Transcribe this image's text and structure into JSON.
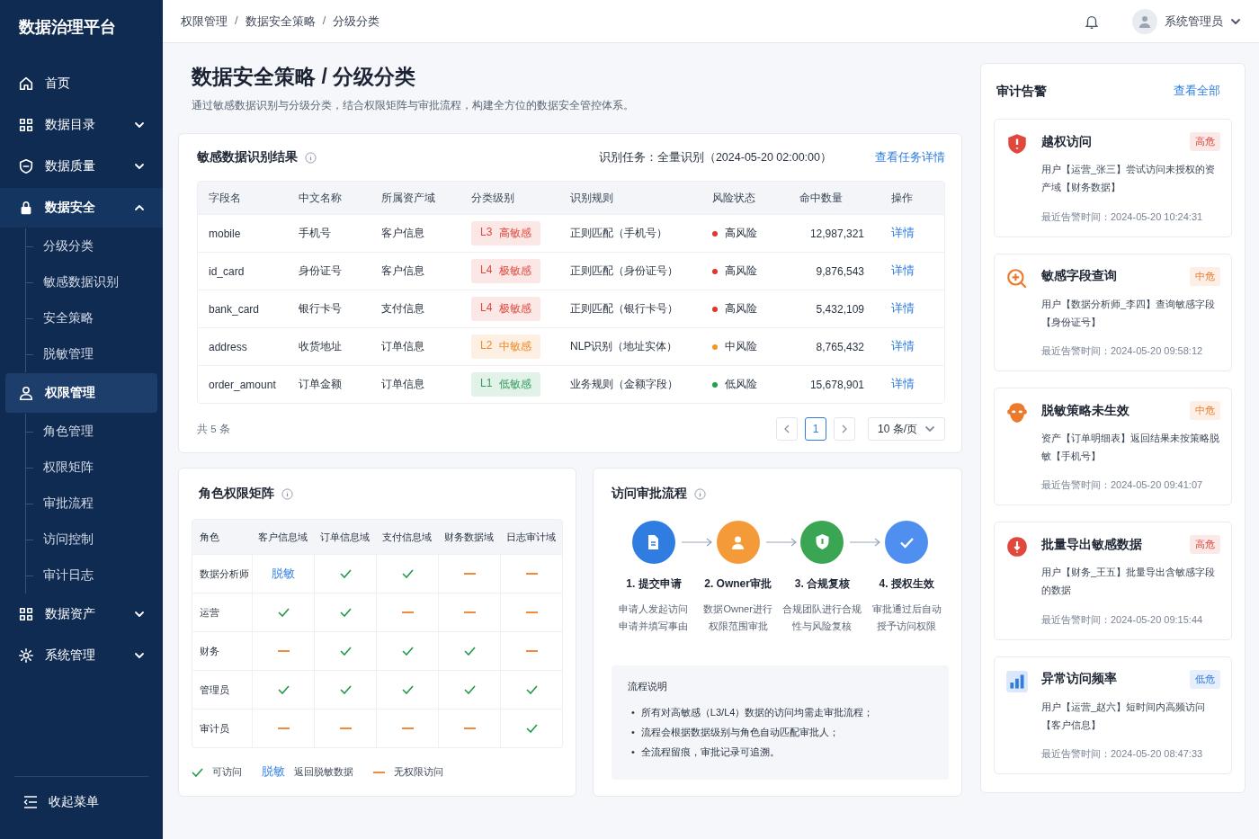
{
  "sidebar": {
    "title": "数据治理平台",
    "items": [
      {
        "label": "首页",
        "selected": false
      },
      {
        "label": "数据目录",
        "selected": false,
        "expanded": false
      },
      {
        "label": "数据质量",
        "selected": false,
        "expanded": false
      },
      {
        "label": "数据安全",
        "selected": false,
        "expanded": true,
        "children": [
          {
            "label": "分级分类",
            "selected": false
          },
          {
            "label": "敏感数据识别",
            "selected": false
          },
          {
            "label": "安全策略",
            "selected": false
          },
          {
            "label": "脱敏管理",
            "selected": false
          }
        ]
      },
      {
        "label": "权限管理",
        "selected": true,
        "children": [
          {
            "label": "角色管理",
            "selected": false
          },
          {
            "label": "权限矩阵",
            "selected": false
          },
          {
            "label": "审批流程",
            "selected": false
          },
          {
            "label": "访问控制",
            "selected": false
          },
          {
            "label": "审计日志",
            "selected": false
          }
        ]
      },
      {
        "label": "数据资产",
        "selected": false,
        "expanded": false
      },
      {
        "label": "系统管理",
        "selected": false,
        "expanded": false
      }
    ],
    "collapse": "收起菜单"
  },
  "topbar": {
    "breadcrumb": [
      "权限管理",
      "数据安全策略",
      "分级分类"
    ],
    "separator": "/",
    "user": "系统管理员"
  },
  "page": {
    "title": "数据安全策略 / 分级分类",
    "subtitle": "通过敏感数据识别与分级分类，结合权限矩阵与审批流程，构建全方位的数据安全管控体系。"
  },
  "recognition": {
    "title": "敏感数据识别结果",
    "task": "识别任务：全量识别（2024-05-20 02:00:00）",
    "task_link": "查看任务详情",
    "columns": [
      "字段名",
      "中文名称",
      "所属资产域",
      "分类级别",
      "识别规则",
      "风险状态",
      "命中数量",
      "操作"
    ],
    "rows": [
      {
        "field": "mobile",
        "name": "手机号",
        "domain": "客户信息",
        "level": {
          "code": "L3",
          "label": "高敏感",
          "color": "#e0483e"
        },
        "rule": "正则匹配（手机号）",
        "risk": {
          "label": "高风险",
          "color": "#e0362c"
        },
        "count": "12,987,321",
        "action": "详情"
      },
      {
        "field": "id_card",
        "name": "身份证号",
        "domain": "客户信息",
        "level": {
          "code": "L4",
          "label": "极敏感",
          "color": "#e0483e"
        },
        "rule": "正则匹配（身份证号）",
        "risk": {
          "label": "高风险",
          "color": "#e0362c"
        },
        "count": "9,876,543",
        "action": "详情"
      },
      {
        "field": "bank_card",
        "name": "银行卡号",
        "domain": "支付信息",
        "level": {
          "code": "L4",
          "label": "极敏感",
          "color": "#e0483e"
        },
        "rule": "正则匹配（银行卡号）",
        "risk": {
          "label": "高风险",
          "color": "#e0362c"
        },
        "count": "5,432,109",
        "action": "详情"
      },
      {
        "field": "address",
        "name": "收货地址",
        "domain": "订单信息",
        "level": {
          "code": "L2",
          "label": "中敏感",
          "color": "#f08a24"
        },
        "rule": "NLP识别（地址实体）",
        "risk": {
          "label": "中风险",
          "color": "#f5961f"
        },
        "count": "8,765,432",
        "action": "详情"
      },
      {
        "field": "order_amount",
        "name": "订单金额",
        "domain": "订单信息",
        "level": {
          "code": "L1",
          "label": "低敏感",
          "color": "#2f9a5c"
        },
        "rule": "业务规则（金额字段）",
        "risk": {
          "label": "低风险",
          "color": "#1fa34a"
        },
        "count": "15,678,901",
        "action": "详情"
      }
    ],
    "total": "共 5 条",
    "pages": [
      {
        "label": "1",
        "selected": true
      }
    ],
    "page_size": "10 条/页"
  },
  "matrix": {
    "title": "角色权限矩阵",
    "columns": [
      "角色",
      "客户信息域",
      "订单信息域",
      "支付信息域",
      "财务数据域",
      "日志审计域"
    ],
    "rows": [
      {
        "cells": [
          {
            "kind": "role",
            "text": "数据分析师"
          },
          {
            "kind": "masked",
            "text": "脱敏"
          },
          {
            "kind": "allow"
          },
          {
            "kind": "allow"
          },
          {
            "kind": "deny"
          },
          {
            "kind": "deny"
          }
        ]
      },
      {
        "cells": [
          {
            "kind": "role",
            "text": "运营"
          },
          {
            "kind": "allow"
          },
          {
            "kind": "allow"
          },
          {
            "kind": "deny"
          },
          {
            "kind": "deny"
          },
          {
            "kind": "deny"
          }
        ]
      },
      {
        "cells": [
          {
            "kind": "role",
            "text": "财务"
          },
          {
            "kind": "deny"
          },
          {
            "kind": "allow"
          },
          {
            "kind": "allow"
          },
          {
            "kind": "allow"
          },
          {
            "kind": "deny"
          }
        ]
      },
      {
        "cells": [
          {
            "kind": "role",
            "text": "管理员"
          },
          {
            "kind": "allow"
          },
          {
            "kind": "allow"
          },
          {
            "kind": "allow"
          },
          {
            "kind": "allow"
          },
          {
            "kind": "allow"
          }
        ]
      },
      {
        "cells": [
          {
            "kind": "role",
            "text": "审计员"
          },
          {
            "kind": "deny"
          },
          {
            "kind": "deny"
          },
          {
            "kind": "deny"
          },
          {
            "kind": "deny"
          },
          {
            "kind": "allow"
          }
        ]
      }
    ],
    "legend": [
      {
        "kind": "allow",
        "label": "可访问"
      },
      {
        "kind": "masked",
        "text": "脱敏",
        "label": "返回脱敏数据"
      },
      {
        "kind": "deny",
        "label": "无权限访问"
      }
    ]
  },
  "flow": {
    "title": "访问审批流程",
    "steps": [
      {
        "title": "1. 提交申请",
        "lines": [
          "申请人发起访问",
          "申请并填写事由"
        ],
        "color": "#2f7de1"
      },
      {
        "title": "2. Owner审批",
        "lines": [
          "数据Owner进行",
          "权限范围审批"
        ],
        "color": "#f59a38"
      },
      {
        "title": "3. 合规复核",
        "lines": [
          "合规团队进行合规",
          "性与风险复核"
        ],
        "color": "#3aa552"
      },
      {
        "title": "4. 授权生效",
        "lines": [
          "审批通过后自动",
          "授予访问权限"
        ],
        "color": "#4f8ff0"
      }
    ],
    "notes_title": "流程说明",
    "bullet": "•",
    "notes": [
      "所有对高敏感（L3/L4）数据的访问均需走审批流程；",
      "流程会根据数据级别与角色自动匹配审批人；",
      "全流程留痕，审批记录可追溯。"
    ]
  },
  "alerts": {
    "title": "审计告警",
    "link": "查看全部",
    "items": [
      {
        "title": "越权访问",
        "level": "高危",
        "color": "#e0483e",
        "desc": "用户【运营_张三】尝试访问未授权的资产域【财务数据】",
        "time": "最近告警时间：2024-05-20 10:24:31"
      },
      {
        "title": "敏感字段查询",
        "level": "中危",
        "color": "#ec7a2c",
        "desc": "用户【数据分析师_李四】查询敏感字段【身份证号】",
        "time": "最近告警时间：2024-05-20 09:58:12"
      },
      {
        "title": "脱敏策略未生效",
        "level": "中危",
        "color": "#ec7a2c",
        "desc": "资产【订单明细表】返回结果未按策略脱敏【手机号】",
        "time": "最近告警时间：2024-05-20 09:41:07"
      },
      {
        "title": "批量导出敏感数据",
        "level": "高危",
        "color": "#e0483e",
        "desc": "用户【财务_王五】批量导出含敏感字段的数据",
        "time": "最近告警时间：2024-05-20 09:15:44"
      },
      {
        "title": "异常访问频率",
        "level": "低危",
        "color": "#2f7de1",
        "desc": "用户【运营_赵六】短时间内高频访问【客户信息】",
        "time": "最近告警时间：2024-05-20 08:47:33"
      }
    ]
  }
}
